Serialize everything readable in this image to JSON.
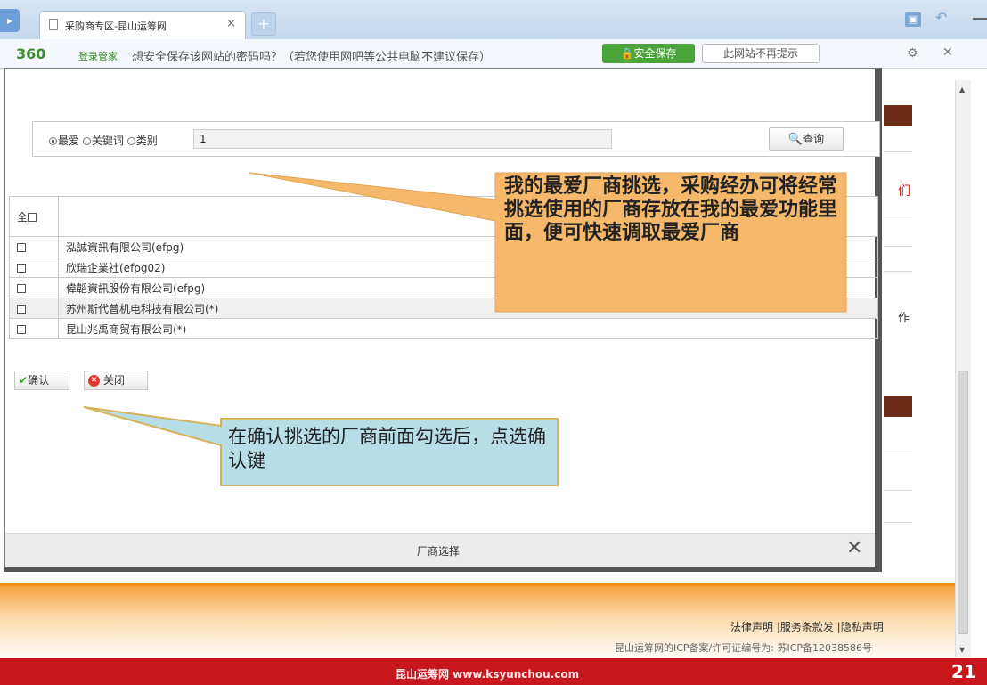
{
  "browser": {
    "tab_title": "采购商专区-昆山运筹网",
    "tab_close": "×",
    "new_tab": "+"
  },
  "password_bar": {
    "logo": "360",
    "logo_sub": "登录管家",
    "message": "想安全保存该网站的密码吗？（若您使用网吧等公共电脑不建议保存）",
    "save_button": "安全保存",
    "never_button": "此网站不再提示"
  },
  "background": {
    "red_text": "们",
    "cell_text": "作"
  },
  "modal": {
    "search": {
      "radio_options": [
        "最爱",
        "关键词",
        "类别"
      ],
      "selected": "最爱",
      "input_value": "1",
      "query_button": "查询"
    },
    "table": {
      "select_all_label": "全",
      "rows": [
        "泓誠資訊有限公司(efpg)",
        "欣瑞企業社(efpg02)",
        "偉韜資訊股份有限公司(efpg)",
        "苏州斯代普机电科技有限公司(*)",
        "昆山兆禹商贸有限公司(*)"
      ]
    },
    "confirm_button": "确认",
    "close_button": "关闭",
    "footer_title": "厂商选择",
    "footer_close": "✕"
  },
  "callouts": {
    "favorites": "我的最爱厂商挑选，采购经办可将经常挑选使用的厂商存放在我的最爱功能里面，便可快速调取最爱厂商",
    "confirm": "在确认挑选的厂商前面勾选后，点选确认键"
  },
  "footer": {
    "links": "法律声明 |服务条款发 |隐私声明",
    "icp": "昆山运筹网的ICP备案/许可证编号为: 苏ICP备12038586号",
    "site": "昆山运筹网  www.ksyunchou.com",
    "slide_number": "21"
  },
  "colors": {
    "accent_green": "#4aa63a",
    "callout_orange": "#f6b86a",
    "callout_teal": "#b7dee6",
    "footer_red": "#c8161d",
    "footer_orange": "#f7a23d"
  }
}
